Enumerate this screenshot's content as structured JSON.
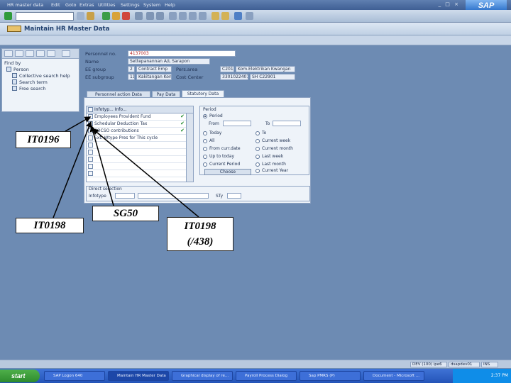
{
  "menu": [
    "HR master data",
    "Edit",
    "Goto",
    "Extras",
    "Utilities",
    "Settings",
    "System",
    "Help"
  ],
  "title": "Maintain HR Master Data",
  "nav_panel": {
    "header": "Find by",
    "items": [
      "Person",
      "Collective search help",
      "Search term",
      "Free search"
    ]
  },
  "header": {
    "personnel_no_label": "Personnel no.",
    "personnel_no": "4137003",
    "name_label": "Name",
    "name": "Settepanannan A/L Sarapon",
    "ee_group_label": "EE group",
    "ee_group_code": "2",
    "ee_group_text": "Contract Emp",
    "pers_area_label": "Pers.area",
    "pers_area_code": "C201",
    "pers_area_text": "Kom.Elektrikan Kwangan",
    "ee_subgroup_label": "EE subgroup",
    "ee_subgroup_code": "11",
    "ee_subgroup_text": "Kakitangan Kon.",
    "cost_center_label": "Cost Center",
    "cost_center": "3301022401",
    "cost_center_text": "SH C22901"
  },
  "tabs": [
    "Personnel action Data",
    "Pay Data",
    "Statutory Data"
  ],
  "wage_types": {
    "header": "Infotyp... Info...",
    "rows": [
      {
        "label": "Employees Provident Fund",
        "ticked": true
      },
      {
        "label": "Schedular Deduction Tax",
        "ticked": true
      },
      {
        "label": "SOCSO contributions",
        "ticked": true
      },
      {
        "label": "Ext. Wtype Pres for This cycle",
        "ticked": false
      }
    ]
  },
  "period": {
    "title": "Period",
    "options_left": [
      "Period",
      "Today",
      "All",
      "From curr.date",
      "Up to today",
      "Current Period"
    ],
    "options_right": [
      "To",
      "Current week",
      "Current month",
      "Last week",
      "Last month",
      "Current Year"
    ],
    "from_label": "From",
    "to_label": "To",
    "choose_label": "Choose"
  },
  "direct_selection": {
    "title": "Direct selection",
    "infotype_label": "Infotype",
    "sty_label": "STy"
  },
  "annotations": {
    "a1": "IT0196",
    "a2": "IT0198",
    "a3": "SG50",
    "a4": "IT0198\n(/438)"
  },
  "statusbar": {
    "system": "DEV (100) ipe6",
    "server": "dsapdev01",
    "mode": "INS"
  },
  "taskbar": {
    "start_label": "start",
    "tasks": [
      "SAP Logon 640",
      "Maintain HR Master Data",
      "Graphical display of re...",
      "Payroll Process Dialog",
      "Sap PMRS (P)",
      "Document - Microsoft ..."
    ],
    "clock": "2:37 PM"
  }
}
